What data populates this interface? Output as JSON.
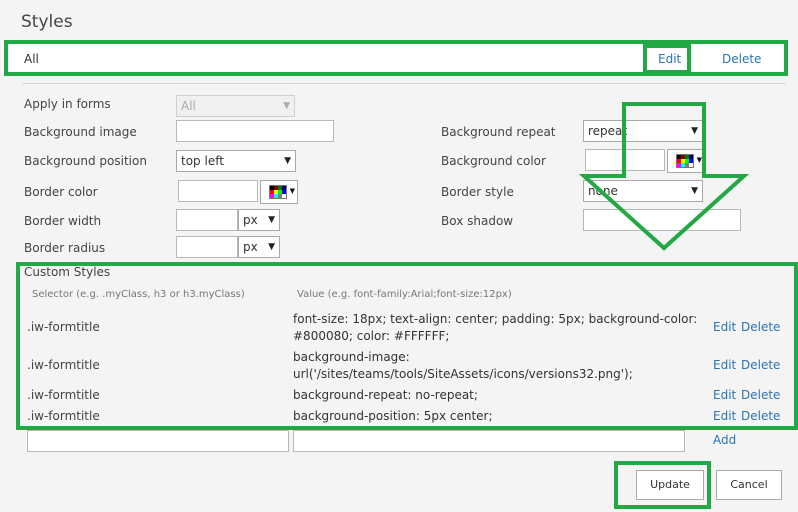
{
  "panel": {
    "title": "Styles"
  },
  "style_row": {
    "name": "All",
    "edit_label": "Edit",
    "delete_label": "Delete"
  },
  "form": {
    "apply_in_forms": {
      "label": "Apply in forms",
      "value": "All"
    },
    "background_image": {
      "label": "Background image",
      "value": ""
    },
    "background_repeat": {
      "label": "Background repeat",
      "value": "repeat"
    },
    "background_position": {
      "label": "Background position",
      "value": "top left"
    },
    "background_color": {
      "label": "Background color",
      "value": ""
    },
    "border_color": {
      "label": "Border color",
      "value": ""
    },
    "border_style": {
      "label": "Border style",
      "value": "none"
    },
    "border_width": {
      "label": "Border width",
      "value": "",
      "unit": "px"
    },
    "box_shadow": {
      "label": "Box shadow",
      "value": ""
    },
    "border_radius": {
      "label": "Border radius",
      "value": "",
      "unit": "px"
    }
  },
  "custom_styles": {
    "heading": "Custom Styles",
    "selector_hint": "Selector (e.g. .myClass, h3 or h3.myClass)",
    "value_hint": "Value (e.g. font-family:Arial;font-size:12px)",
    "rows": [
      {
        "selector": ".iw-formtitle",
        "value_line1": "font-size: 18px; text-align: center; padding: 5px; background-color:",
        "value_line2": "#800080; color: #FFFFFF;",
        "edit": "Edit",
        "delete": "Delete"
      },
      {
        "selector": ".iw-formtitle",
        "value_line1": "background-image:",
        "value_line2": "url('/sites/teams/tools/SiteAssets/icons/versions32.png');",
        "edit": "Edit",
        "delete": "Delete"
      },
      {
        "selector": ".iw-formtitle",
        "value_line1": "background-repeat: no-repeat;",
        "value_line2": "",
        "edit": "Edit",
        "delete": "Delete"
      },
      {
        "selector": ".iw-formtitle",
        "value_line1": "background-position: 5px center;",
        "value_line2": "",
        "edit": "Edit",
        "delete": "Delete"
      }
    ],
    "new_selector": "",
    "new_value": "",
    "add_label": "Add"
  },
  "buttons": {
    "update": "Update",
    "cancel": "Cancel"
  },
  "colors": {
    "highlight": "#22a845",
    "link": "#2b74b5"
  },
  "icons": {
    "color_picker": "color-palette-icon",
    "dropdown": "chevron-down-icon"
  }
}
